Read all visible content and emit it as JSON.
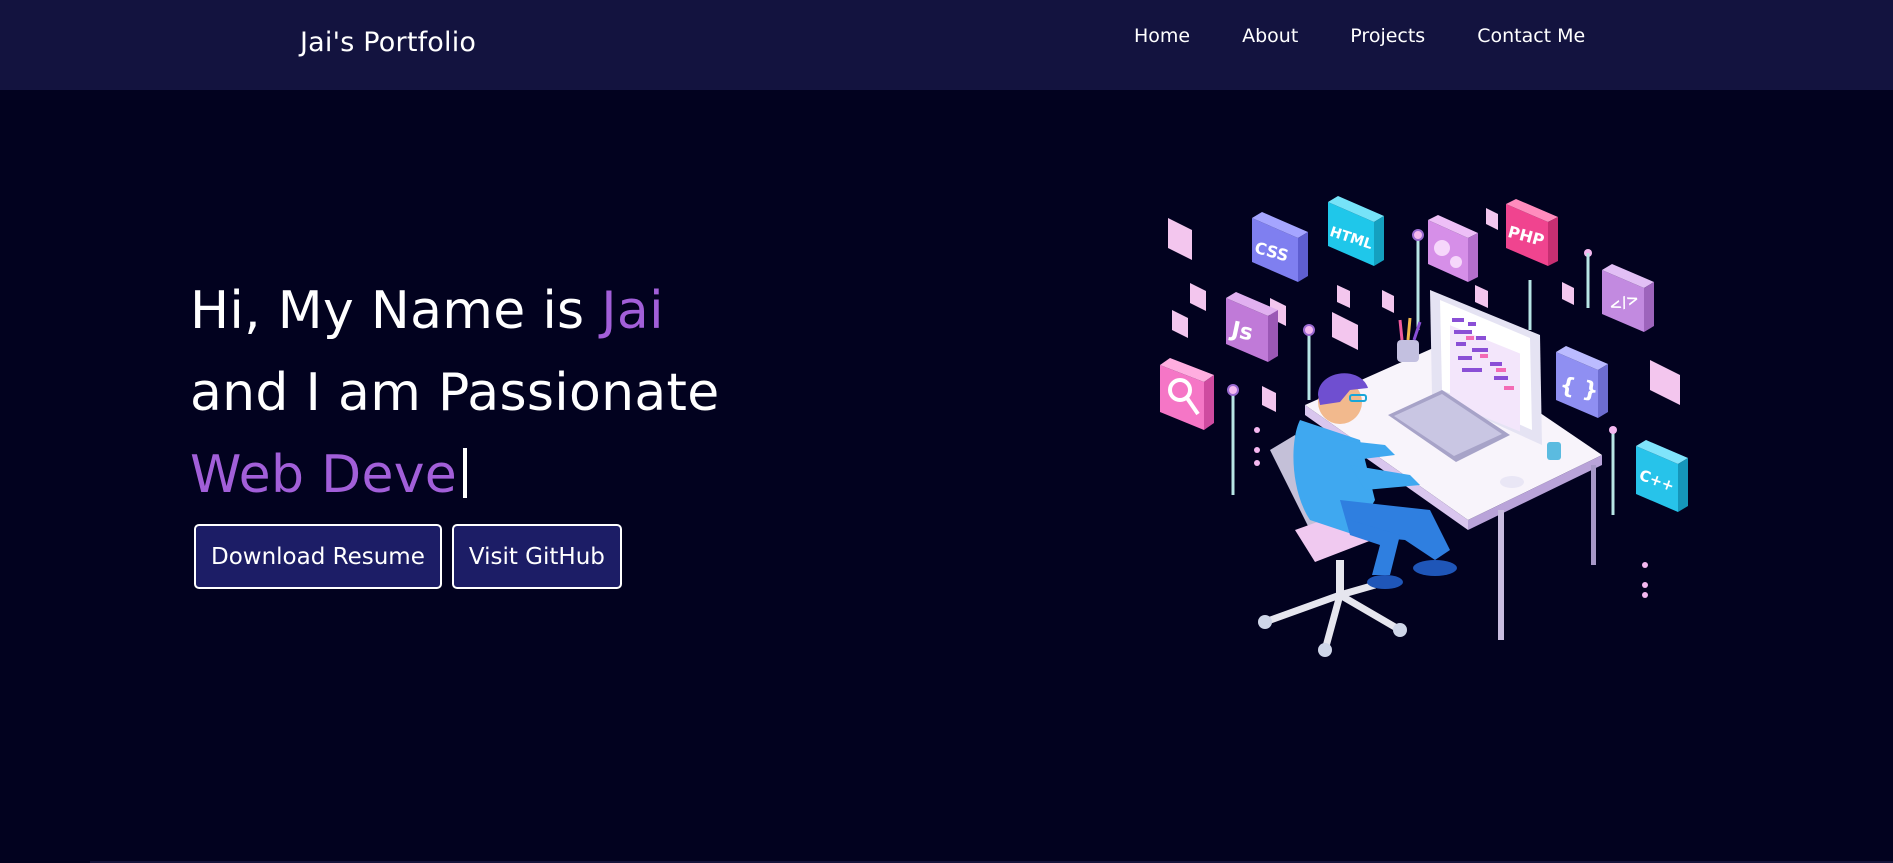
{
  "navbar": {
    "brand": "Jai's Portfolio",
    "links": [
      "Home",
      "About",
      "Projects",
      "Contact Me"
    ]
  },
  "hero": {
    "line1_prefix": "Hi, My Name is ",
    "line1_name": "Jai",
    "line2": "and I am Passionate",
    "line3_typed": "Web Deve",
    "buttons": {
      "download_resume": "Download Resume",
      "visit_github": "Visit GitHub"
    }
  },
  "illustration": {
    "icon_labels": [
      "CSS",
      "HTML",
      "PHP",
      "Js",
      "</>",
      "{ }",
      "C++"
    ]
  },
  "colors": {
    "background": "#02021f",
    "navbar": "#13133f",
    "accent": "#a25fd9",
    "button": "#1c1d66"
  }
}
